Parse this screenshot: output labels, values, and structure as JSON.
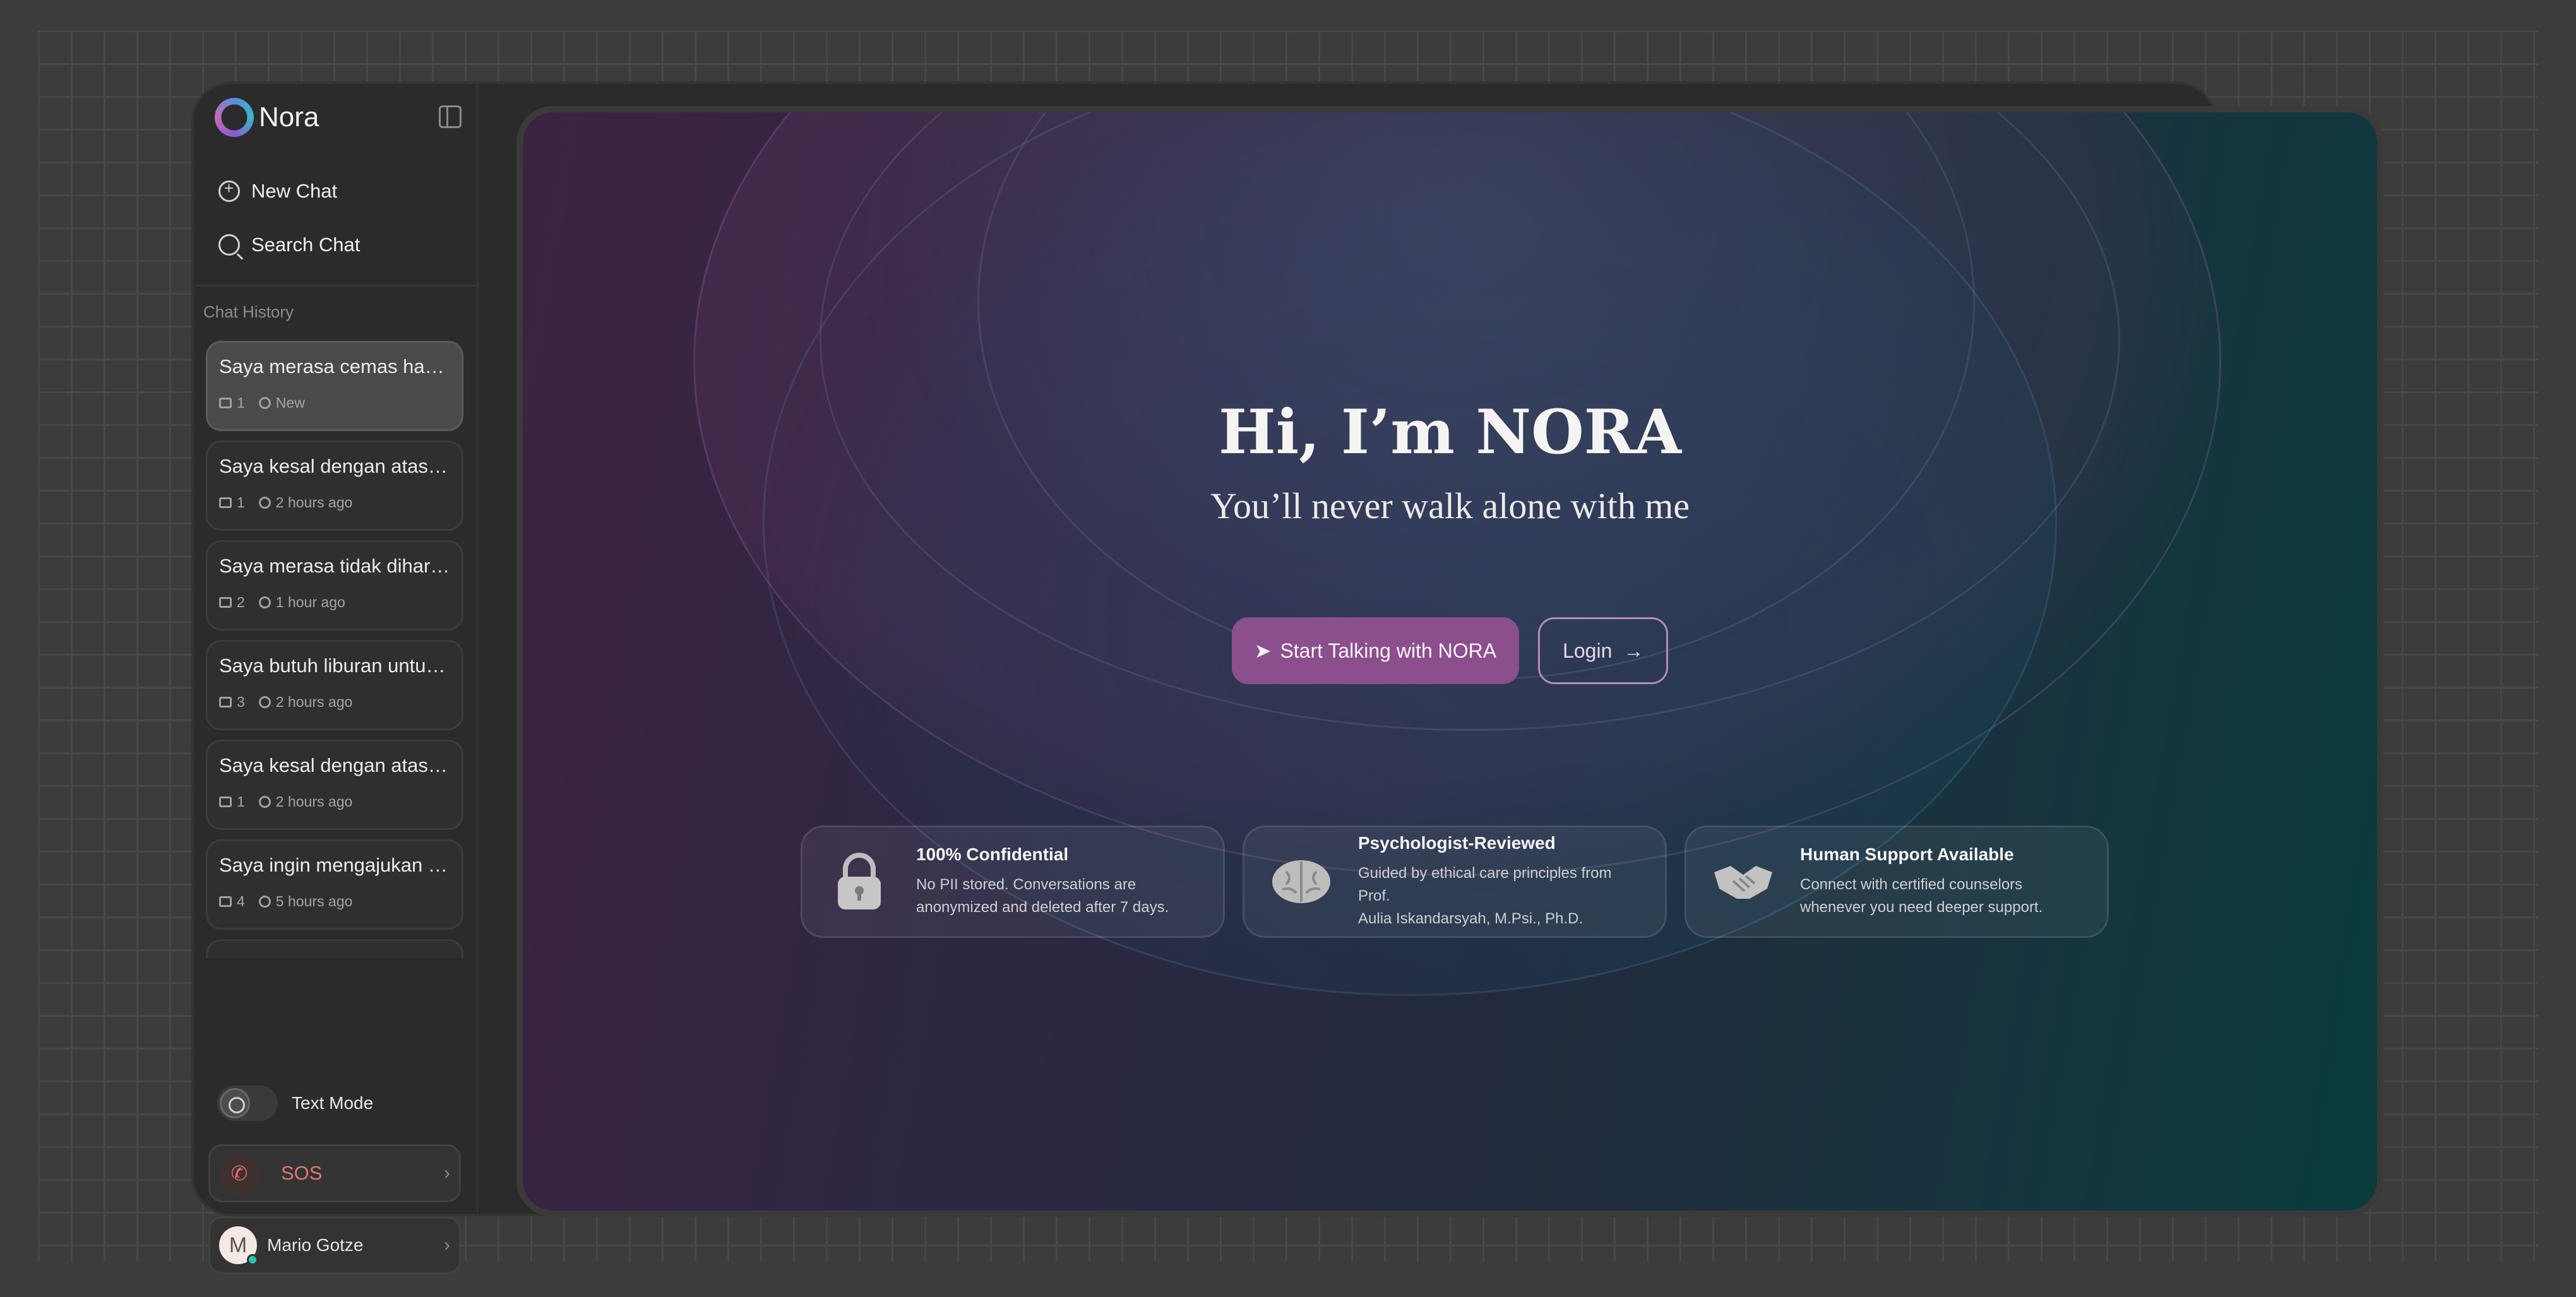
{
  "app": {
    "name": "Nora"
  },
  "sidebar": {
    "new_chat": "New Chat",
    "search_chat": "Search Chat",
    "history_label": "Chat History",
    "history": [
      {
        "title": "Saya merasa cemas harini...",
        "count": "1",
        "time": "New",
        "active": true
      },
      {
        "title": "Saya kesal dengan atasan...",
        "count": "1",
        "time": "2 hours ago"
      },
      {
        "title": "Saya merasa tidak diharg...",
        "count": "2",
        "time": "1 hour ago"
      },
      {
        "title": "Saya butuh liburan untuk...",
        "count": "3",
        "time": "2 hours ago"
      },
      {
        "title": "Saya kesal dengan atasan...",
        "count": "1",
        "time": "2 hours ago"
      },
      {
        "title": "Saya ingin mengajukan id...",
        "count": "4",
        "time": "5 hours ago"
      }
    ],
    "text_mode_label": "Text Mode",
    "sos_label": "SOS",
    "user": {
      "initial": "M",
      "name": "Mario Gotze",
      "status": "online"
    }
  },
  "hero": {
    "title": "Hi, I’m NORA",
    "subtitle": "You’ll never walk alone with me",
    "primary_cta": "Start Talking with NORA",
    "login_cta": "Login"
  },
  "features": [
    {
      "icon": "lock-icon",
      "title": "100% Confidential",
      "desc_line1": "No PII stored. Conversations are",
      "desc_line2": "anonymized and deleted after 7 days."
    },
    {
      "icon": "brain-icon",
      "title": "Psychologist-Reviewed",
      "desc_line1": "Guided by ethical care principles from Prof.",
      "desc_line2": "Aulia Iskandarsyah, M.Psi., Ph.D."
    },
    {
      "icon": "handshake-icon",
      "title": "Human Support Available",
      "desc_line1": "Connect with certified counselors",
      "desc_line2": "whenever you need deeper support."
    }
  ],
  "colors": {
    "accent": "#8a4f8c",
    "sos": "#e07878",
    "online": "#2bc4b0"
  }
}
